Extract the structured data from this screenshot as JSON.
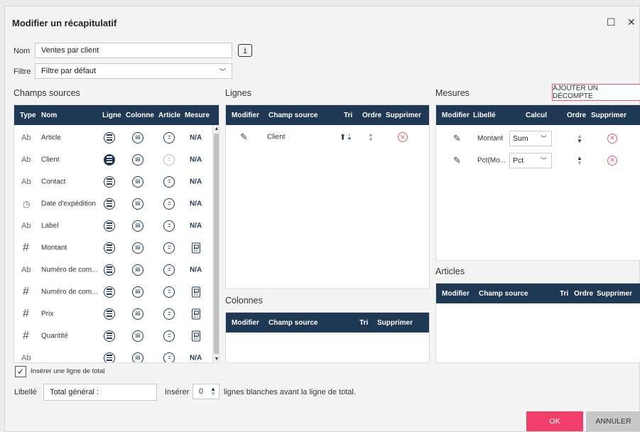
{
  "dialog": {
    "title": "Modifier un récapitulatif",
    "maximize_icon": "maximize-icon",
    "close_icon": "close-icon"
  },
  "form": {
    "name_label": "Nom",
    "name_value": "Ventes par client",
    "info_icon": "i",
    "filter_label": "Filtre",
    "filter_value": "Filtre par défaut"
  },
  "sources": {
    "title": "Champs sources",
    "headers": {
      "type": "Type",
      "name": "Nom",
      "line": "Ligne",
      "column": "Colonne",
      "article": "Article",
      "measure": "Mesure"
    },
    "rows": [
      {
        "type": "Ab",
        "name": "Article",
        "measure": "N/A"
      },
      {
        "type": "Ab",
        "name": "Client",
        "measure": "N/A"
      },
      {
        "type": "Ab",
        "name": "Contact",
        "measure": "N/A"
      },
      {
        "type": "clock",
        "name": "Date d'expédition",
        "measure": "N/A"
      },
      {
        "type": "Ab",
        "name": "Label",
        "measure": "N/A"
      },
      {
        "type": "#",
        "name": "Montant",
        "measure": "calc"
      },
      {
        "type": "Ab",
        "name": "Numéro de com...",
        "measure": "N/A"
      },
      {
        "type": "#",
        "name": "Numéro de com...",
        "measure": "calc"
      },
      {
        "type": "#",
        "name": "Prix",
        "measure": "calc"
      },
      {
        "type": "#",
        "name": "Quantité",
        "measure": "calc"
      }
    ],
    "partial_row": {
      "type": "Ab",
      "measure": "N/A"
    }
  },
  "lines": {
    "title": "Lignes",
    "headers": {
      "edit": "Modifier",
      "field": "Champ source",
      "sort": "Tri",
      "order": "Ordre",
      "delete": "Supprimer"
    },
    "rows": [
      {
        "field": "Client"
      }
    ]
  },
  "columns": {
    "title": "Colonnes",
    "headers": {
      "edit": "Modifier",
      "field": "Champ source",
      "sort": "Tri",
      "delete": "Supprimer"
    }
  },
  "measures": {
    "title": "Mesures",
    "add_button": "AJOUTER UN DÉCOMPTE",
    "headers": {
      "edit": "Modifier",
      "label": "Libellé",
      "calc": "Calcul",
      "order": "Ordre",
      "delete": "Supprimer"
    },
    "rows": [
      {
        "label": "Montant",
        "calc": "Sum"
      },
      {
        "label": "Pct(Mo...",
        "calc": "Pct"
      }
    ]
  },
  "articles": {
    "title": "Articles",
    "headers": {
      "edit": "Modifier",
      "field": "Champ source",
      "sort": "Tri",
      "order": "Ordre",
      "delete": "Supprimer"
    }
  },
  "footer": {
    "total_checkbox_label": "Insérer une ligne de total",
    "total_checked": true,
    "libelle_label": "Libellé",
    "libelle_value": "Total général :",
    "insert_label": "Insérer",
    "insert_value": "0",
    "insert_suffix": "lignes blanches avant la ligne de total.",
    "ok": "OK",
    "cancel": "ANNULER"
  },
  "colors": {
    "header": "#1f3954",
    "accent": "#ef3f6a",
    "remove": "#e06070"
  }
}
